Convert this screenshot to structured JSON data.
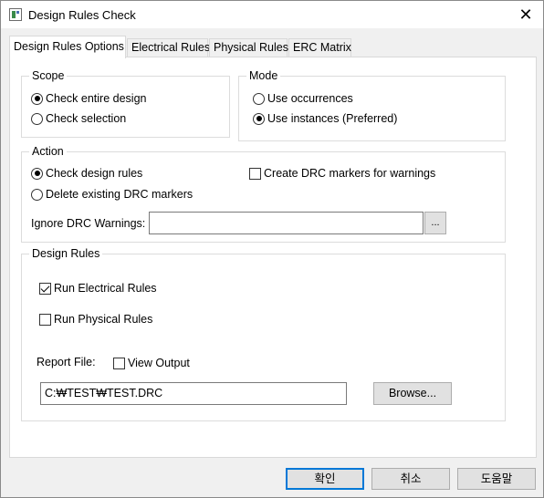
{
  "window": {
    "title": "Design Rules Check",
    "close_glyph": "✕"
  },
  "tabs": [
    {
      "label": "Design Rules Options"
    },
    {
      "label": "Electrical Rules"
    },
    {
      "label": "Physical Rules"
    },
    {
      "label": "ERC Matrix"
    }
  ],
  "scope": {
    "legend": "Scope",
    "options": [
      {
        "label": "Check entire design",
        "selected": true
      },
      {
        "label": "Check selection",
        "selected": false
      }
    ]
  },
  "mode": {
    "legend": "Mode",
    "options": [
      {
        "label": "Use occurrences",
        "selected": false
      },
      {
        "label": "Use instances (Preferred)",
        "selected": true
      }
    ]
  },
  "action": {
    "legend": "Action",
    "options": [
      {
        "label": "Check design rules",
        "selected": true
      },
      {
        "label": "Delete existing DRC markers",
        "selected": false
      }
    ],
    "create_markers_label": "Create DRC markers for warnings",
    "ignore_label": "Ignore DRC Warnings:",
    "ignore_value": "",
    "ellipsis_label": "..."
  },
  "design_rules": {
    "legend": "Design Rules",
    "run_electrical_label": "Run Electrical Rules",
    "run_physical_label": "Run Physical Rules",
    "report_file_label": "Report File:",
    "view_output_label": "View Output",
    "report_file_value": "C:₩TEST₩TEST.DRC",
    "browse_label": "Browse..."
  },
  "footer": {
    "ok_label": "확인",
    "cancel_label": "취소",
    "help_label": "도움말"
  }
}
